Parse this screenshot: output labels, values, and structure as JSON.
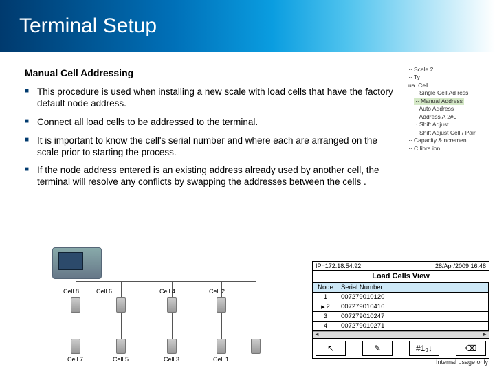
{
  "banner": {
    "title": "Terminal Setup"
  },
  "sub": "Manual Cell Addressing",
  "bullets": [
    "This procedure is used when installing a new scale with load cells that have the factory default node address.",
    "Connect all load cells to be addressed to the terminal.",
    "It is important to know the cell's serial number and where each are arranged on the scale prior to starting the process.",
    "If the node address entered is an existing address already used by another cell, the terminal will resolve any conflicts by swapping the addresses between the cells ."
  ],
  "tree": {
    "l0a": "·· Scale 2",
    "l0b": "·· Ty",
    "l0c": "ua. Cell",
    "l1a": "·· Single Cell Ad ress",
    "l1sel": "·· Manual Address",
    "l1b": "·· Auto Address",
    "l1c": "·· Address A   2#0",
    "l1d": "·· Shift Adjust",
    "l1e": "·· Shift Adjust Cell / Pair",
    "l2a": "·· Capacity &  ncrement",
    "l2b": "·· C libra ion"
  },
  "cells": {
    "c1": "Cell 1",
    "c2": "Cell 2",
    "c3": "Cell 3",
    "c4": "Cell 4",
    "c5": "Cell 5",
    "c6": "Cell 6",
    "c7": "Cell 7",
    "c8": "Cell 8"
  },
  "lcv": {
    "ip": "IP=172.18.54.92",
    "dt": "28/Apr/2009 16:48",
    "title": "Load Cells View",
    "h1": "Node",
    "h2": "Serial Number",
    "rows": [
      {
        "n": "1",
        "s": "007279010120"
      },
      {
        "n": "2",
        "s": "007279010416"
      },
      {
        "n": "3",
        "s": "007279010247"
      },
      {
        "n": "4",
        "s": "007279010271"
      }
    ],
    "keys": {
      "k1": "↖",
      "k2": "✎",
      "k3": "#1₉↓",
      "k4": "⌫"
    }
  },
  "footer": "Internal usage only"
}
